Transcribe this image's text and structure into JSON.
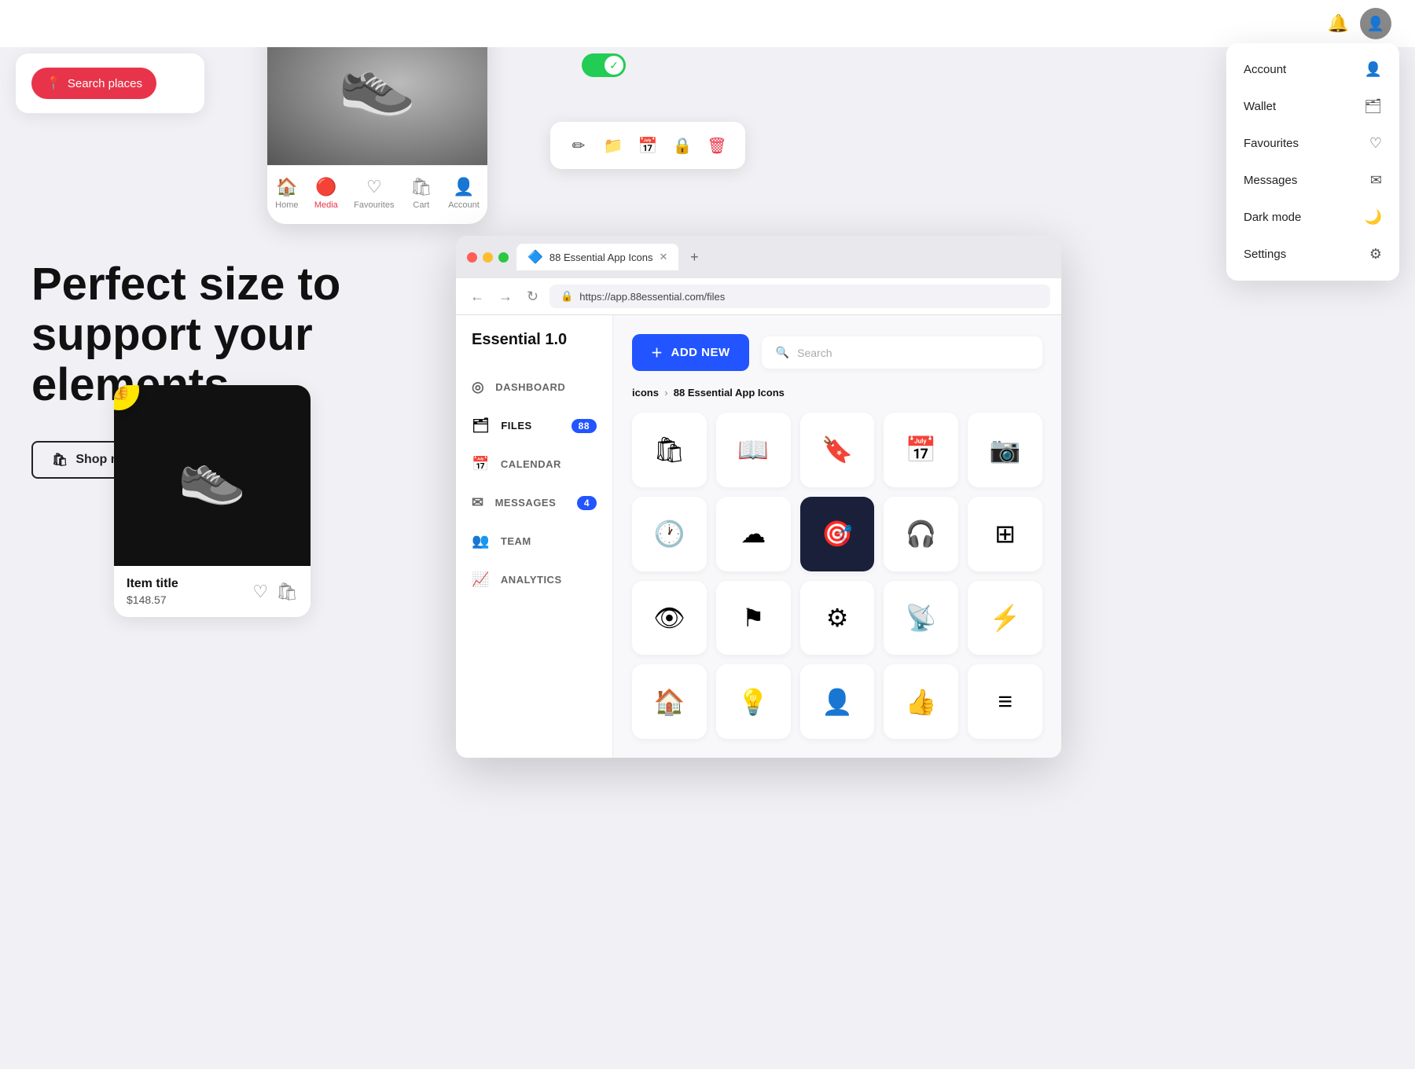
{
  "topbar": {
    "bell_icon": "🔔",
    "avatar_char": "👤"
  },
  "dropdown": {
    "items": [
      {
        "label": "Account",
        "icon": "👤"
      },
      {
        "label": "Wallet",
        "icon": "🗂"
      },
      {
        "label": "Favourites",
        "icon": "♡"
      },
      {
        "label": "Messages",
        "icon": "✉"
      },
      {
        "label": "Dark mode",
        "icon": "🌙"
      },
      {
        "label": "Settings",
        "icon": "⚙"
      }
    ]
  },
  "search_places": {
    "label": "Search places",
    "icon": "📍"
  },
  "mobile_nav": {
    "items": [
      {
        "label": "Home",
        "icon": "🏠",
        "active": false
      },
      {
        "label": "Media",
        "icon": "🔴",
        "active": true
      },
      {
        "label": "Favourites",
        "icon": "♡",
        "active": false
      },
      {
        "label": "Cart",
        "icon": "🛍",
        "active": false
      },
      {
        "label": "Account",
        "icon": "👤",
        "active": false
      }
    ]
  },
  "hero": {
    "title": "Perfect size to support your elements",
    "shop_now": "Shop now"
  },
  "product_card": {
    "title": "Item title",
    "price": "$148.57"
  },
  "browser": {
    "tab_label": "88 Essential App Icons",
    "url": "https://app.88essential.com/files",
    "new_tab_icon": "+"
  },
  "app": {
    "brand": "Essential 1.0",
    "add_new": "ADD NEW",
    "search_placeholder": "Search",
    "breadcrumb_root": "icons",
    "breadcrumb_current": "88 Essential App Icons",
    "sidebar_items": [
      {
        "label": "DASHBOARD",
        "icon": "◎",
        "badge": null
      },
      {
        "label": "FILES",
        "icon": "🗂",
        "badge": "88"
      },
      {
        "label": "CALENDAR",
        "icon": "📅",
        "badge": null
      },
      {
        "label": "MESSAGES",
        "icon": "✉",
        "badge": "4"
      },
      {
        "label": "TEAM",
        "icon": "👥",
        "badge": null
      },
      {
        "label": "ANALYTICS",
        "icon": "📈",
        "badge": null
      }
    ],
    "icons": [
      {
        "glyph": "🛍",
        "selected": false
      },
      {
        "glyph": "📖",
        "selected": false
      },
      {
        "glyph": "🔖",
        "selected": false
      },
      {
        "glyph": "📅",
        "selected": false
      },
      {
        "glyph": "📷",
        "selected": false
      },
      {
        "glyph": "🕐",
        "selected": false
      },
      {
        "glyph": "☁",
        "selected": false
      },
      {
        "glyph": "🎯",
        "selected": true
      },
      {
        "glyph": "🎧",
        "selected": false
      },
      {
        "glyph": "⊞",
        "selected": false
      },
      {
        "glyph": "👁",
        "selected": false
      },
      {
        "glyph": "⚑",
        "selected": false
      },
      {
        "glyph": "⚙",
        "selected": false
      },
      {
        "glyph": "📡",
        "selected": false
      },
      {
        "glyph": "⚡",
        "selected": false
      },
      {
        "glyph": "🏠",
        "selected": false
      },
      {
        "glyph": "💡",
        "selected": false
      },
      {
        "glyph": "👤",
        "selected": false
      },
      {
        "glyph": "👍",
        "selected": false
      },
      {
        "glyph": "≡",
        "selected": false
      }
    ]
  },
  "toolbar_icons": [
    {
      "glyph": "✏",
      "label": "edit-icon",
      "red": false
    },
    {
      "glyph": "📁",
      "label": "folder-icon",
      "red": false
    },
    {
      "glyph": "📅",
      "label": "calendar-icon",
      "red": false
    },
    {
      "glyph": "🔒",
      "label": "lock-icon",
      "red": false
    },
    {
      "glyph": "🗑",
      "label": "trash-icon",
      "red": true
    }
  ]
}
